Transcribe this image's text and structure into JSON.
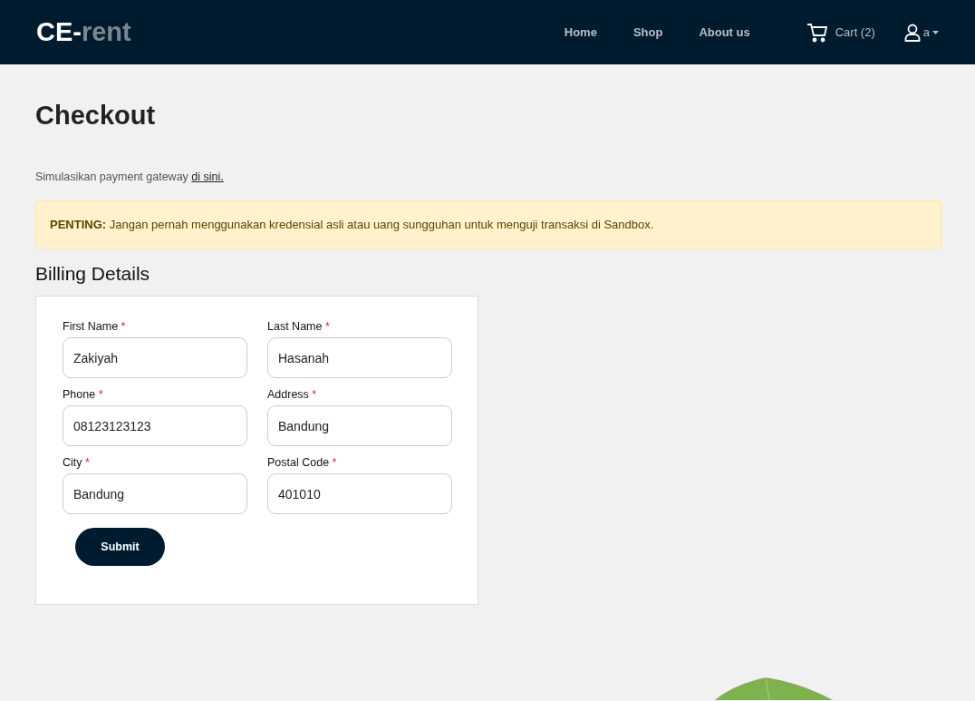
{
  "header": {
    "logo": {
      "prefix": "CE-",
      "suffix": "rent"
    },
    "nav": [
      "Home",
      "Shop",
      "About us"
    ],
    "cart": "Cart (2)",
    "user": "a"
  },
  "page": {
    "title": "Checkout",
    "note": {
      "text": "Simulasikan payment gateway",
      "link": "di sini."
    },
    "alert": "**PENTING:** Jangan pernah menggunakan kredensial asli atau uang sungguhan untuk menguji transaksi di Sandbox.",
    "section_title": "Billing Details",
    "fields": [
      {
        "label": "First Name",
        "mark": "*",
        "value": "Zakiyah"
      },
      {
        "label": "Last Name",
        "mark": "*",
        "value": "Hasanah"
      },
      {
        "label": "Phone",
        "mark": "*",
        "value": "08123123123"
      },
      {
        "label": "Address",
        "mark": "*",
        "value": "Bandung"
      },
      {
        "label": "City",
        "mark": "*",
        "value": "Bandung"
      },
      {
        "label": "Postal Code",
        "mark": "*",
        "value": "401010"
      }
    ],
    "submit": "Submit"
  }
}
